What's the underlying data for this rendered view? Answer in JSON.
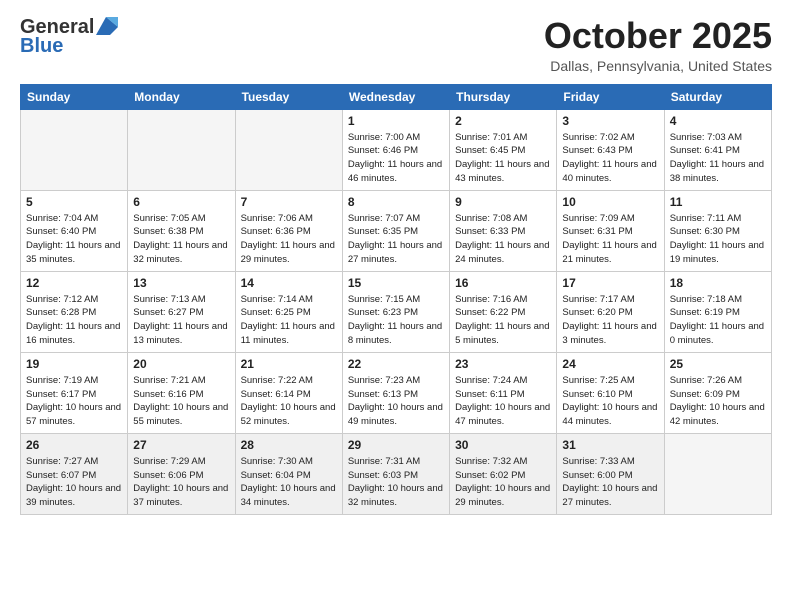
{
  "header": {
    "logo_line1": "General",
    "logo_line2": "Blue",
    "month": "October 2025",
    "location": "Dallas, Pennsylvania, United States"
  },
  "days_of_week": [
    "Sunday",
    "Monday",
    "Tuesday",
    "Wednesday",
    "Thursday",
    "Friday",
    "Saturday"
  ],
  "weeks": [
    [
      {
        "date": "",
        "info": ""
      },
      {
        "date": "",
        "info": ""
      },
      {
        "date": "",
        "info": ""
      },
      {
        "date": "1",
        "info": "Sunrise: 7:00 AM\nSunset: 6:46 PM\nDaylight: 11 hours\nand 46 minutes."
      },
      {
        "date": "2",
        "info": "Sunrise: 7:01 AM\nSunset: 6:45 PM\nDaylight: 11 hours\nand 43 minutes."
      },
      {
        "date": "3",
        "info": "Sunrise: 7:02 AM\nSunset: 6:43 PM\nDaylight: 11 hours\nand 40 minutes."
      },
      {
        "date": "4",
        "info": "Sunrise: 7:03 AM\nSunset: 6:41 PM\nDaylight: 11 hours\nand 38 minutes."
      }
    ],
    [
      {
        "date": "5",
        "info": "Sunrise: 7:04 AM\nSunset: 6:40 PM\nDaylight: 11 hours\nand 35 minutes."
      },
      {
        "date": "6",
        "info": "Sunrise: 7:05 AM\nSunset: 6:38 PM\nDaylight: 11 hours\nand 32 minutes."
      },
      {
        "date": "7",
        "info": "Sunrise: 7:06 AM\nSunset: 6:36 PM\nDaylight: 11 hours\nand 29 minutes."
      },
      {
        "date": "8",
        "info": "Sunrise: 7:07 AM\nSunset: 6:35 PM\nDaylight: 11 hours\nand 27 minutes."
      },
      {
        "date": "9",
        "info": "Sunrise: 7:08 AM\nSunset: 6:33 PM\nDaylight: 11 hours\nand 24 minutes."
      },
      {
        "date": "10",
        "info": "Sunrise: 7:09 AM\nSunset: 6:31 PM\nDaylight: 11 hours\nand 21 minutes."
      },
      {
        "date": "11",
        "info": "Sunrise: 7:11 AM\nSunset: 6:30 PM\nDaylight: 11 hours\nand 19 minutes."
      }
    ],
    [
      {
        "date": "12",
        "info": "Sunrise: 7:12 AM\nSunset: 6:28 PM\nDaylight: 11 hours\nand 16 minutes."
      },
      {
        "date": "13",
        "info": "Sunrise: 7:13 AM\nSunset: 6:27 PM\nDaylight: 11 hours\nand 13 minutes."
      },
      {
        "date": "14",
        "info": "Sunrise: 7:14 AM\nSunset: 6:25 PM\nDaylight: 11 hours\nand 11 minutes."
      },
      {
        "date": "15",
        "info": "Sunrise: 7:15 AM\nSunset: 6:23 PM\nDaylight: 11 hours\nand 8 minutes."
      },
      {
        "date": "16",
        "info": "Sunrise: 7:16 AM\nSunset: 6:22 PM\nDaylight: 11 hours\nand 5 minutes."
      },
      {
        "date": "17",
        "info": "Sunrise: 7:17 AM\nSunset: 6:20 PM\nDaylight: 11 hours\nand 3 minutes."
      },
      {
        "date": "18",
        "info": "Sunrise: 7:18 AM\nSunset: 6:19 PM\nDaylight: 11 hours\nand 0 minutes."
      }
    ],
    [
      {
        "date": "19",
        "info": "Sunrise: 7:19 AM\nSunset: 6:17 PM\nDaylight: 10 hours\nand 57 minutes."
      },
      {
        "date": "20",
        "info": "Sunrise: 7:21 AM\nSunset: 6:16 PM\nDaylight: 10 hours\nand 55 minutes."
      },
      {
        "date": "21",
        "info": "Sunrise: 7:22 AM\nSunset: 6:14 PM\nDaylight: 10 hours\nand 52 minutes."
      },
      {
        "date": "22",
        "info": "Sunrise: 7:23 AM\nSunset: 6:13 PM\nDaylight: 10 hours\nand 49 minutes."
      },
      {
        "date": "23",
        "info": "Sunrise: 7:24 AM\nSunset: 6:11 PM\nDaylight: 10 hours\nand 47 minutes."
      },
      {
        "date": "24",
        "info": "Sunrise: 7:25 AM\nSunset: 6:10 PM\nDaylight: 10 hours\nand 44 minutes."
      },
      {
        "date": "25",
        "info": "Sunrise: 7:26 AM\nSunset: 6:09 PM\nDaylight: 10 hours\nand 42 minutes."
      }
    ],
    [
      {
        "date": "26",
        "info": "Sunrise: 7:27 AM\nSunset: 6:07 PM\nDaylight: 10 hours\nand 39 minutes."
      },
      {
        "date": "27",
        "info": "Sunrise: 7:29 AM\nSunset: 6:06 PM\nDaylight: 10 hours\nand 37 minutes."
      },
      {
        "date": "28",
        "info": "Sunrise: 7:30 AM\nSunset: 6:04 PM\nDaylight: 10 hours\nand 34 minutes."
      },
      {
        "date": "29",
        "info": "Sunrise: 7:31 AM\nSunset: 6:03 PM\nDaylight: 10 hours\nand 32 minutes."
      },
      {
        "date": "30",
        "info": "Sunrise: 7:32 AM\nSunset: 6:02 PM\nDaylight: 10 hours\nand 29 minutes."
      },
      {
        "date": "31",
        "info": "Sunrise: 7:33 AM\nSunset: 6:00 PM\nDaylight: 10 hours\nand 27 minutes."
      },
      {
        "date": "",
        "info": ""
      }
    ]
  ]
}
